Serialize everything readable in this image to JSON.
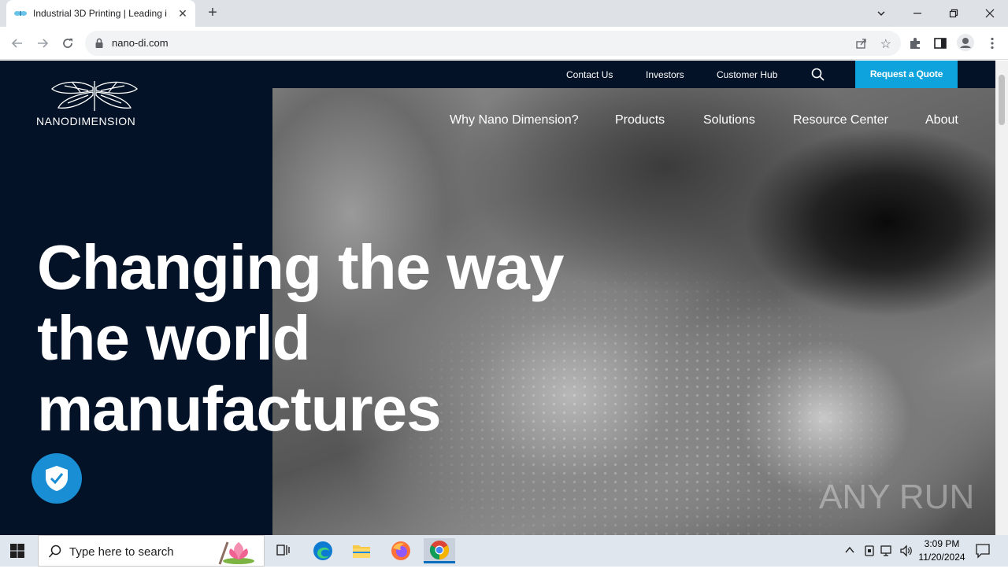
{
  "browser": {
    "tab_title": "Industrial 3D Printing | Leading i",
    "new_tab": "+",
    "url": "nano-di.com"
  },
  "site": {
    "logo_text": "NANODIMENSION",
    "utility_nav": [
      "Contact Us",
      "Investors",
      "Customer Hub"
    ],
    "quote_button": "Request a Quote",
    "main_nav": [
      "Why Nano Dimension?",
      "Products",
      "Solutions",
      "Resource Center",
      "About"
    ],
    "headline": [
      "Changing the way",
      "the world",
      "manufactures"
    ],
    "watermark": "ANY RUN"
  },
  "taskbar": {
    "search_placeholder": "Type here to search",
    "time": "3:09 PM",
    "date": "11/20/2024"
  },
  "colors": {
    "accent": "#0ea3dc",
    "site_bg": "#031227",
    "shield": "#1a8ed4"
  }
}
